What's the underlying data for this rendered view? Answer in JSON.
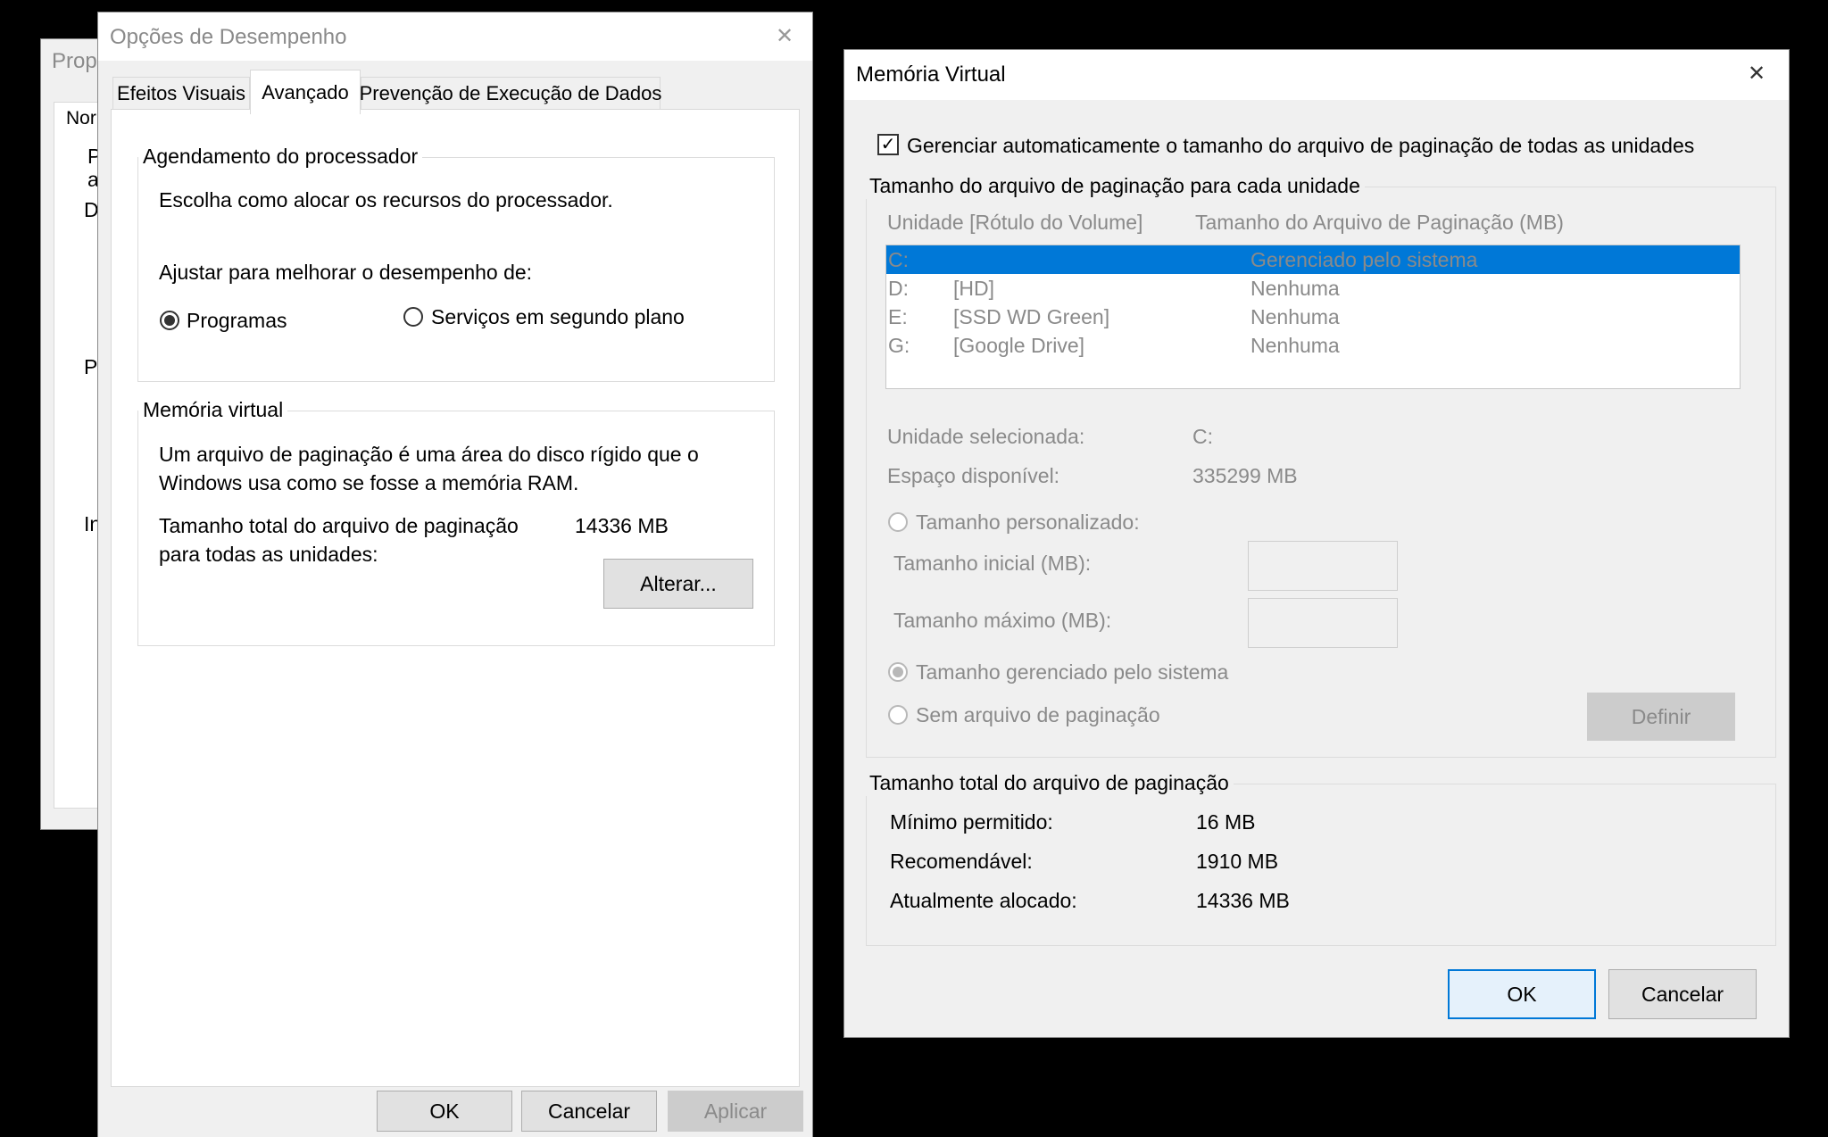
{
  "back_window": {
    "title": "Prop",
    "tab": "Nor",
    "fragments": [
      "P",
      "a",
      "D",
      "P",
      "In"
    ]
  },
  "perf_dialog": {
    "title": "Opções de Desempenho",
    "tabs": [
      {
        "label": "Efeitos Visuais"
      },
      {
        "label": "Avançado"
      },
      {
        "label": "Prevenção de Execução de Dados"
      }
    ],
    "processor_group": {
      "title": "Agendamento do processador",
      "description": "Escolha como alocar os recursos do processador.",
      "adjust_label": "Ajustar para melhorar o desempenho de:",
      "option_programs": "Programas",
      "option_services": "Serviços em segundo plano"
    },
    "vm_group": {
      "title": "Memória virtual",
      "description_line1": "Um arquivo de paginação é uma área do disco rígido que o",
      "description_line2": "Windows usa como se fosse a memória RAM.",
      "total_label_line1": "Tamanho total do arquivo de paginação",
      "total_label_line2": "para todas as unidades:",
      "total_value": "14336 MB",
      "change_button": "Alterar..."
    },
    "buttons": {
      "ok": "OK",
      "cancel": "Cancelar",
      "apply": "Aplicar"
    }
  },
  "vm_dialog": {
    "title": "Memória Virtual",
    "auto_manage_label": "Gerenciar automaticamente o tamanho do arquivo de paginação de todas as unidades",
    "auto_manage_checked": true,
    "drive_group_title": "Tamanho do arquivo de paginação para cada unidade",
    "columns": {
      "drive": "Unidade [Rótulo do Volume]",
      "size": "Tamanho do Arquivo de Paginação (MB)"
    },
    "drives": [
      {
        "letter": "C:",
        "label": "",
        "size": "Gerenciado pelo sistema",
        "selected": true
      },
      {
        "letter": "D:",
        "label": "[HD]",
        "size": "Nenhuma",
        "selected": false
      },
      {
        "letter": "E:",
        "label": "[SSD WD Green]",
        "size": "Nenhuma",
        "selected": false
      },
      {
        "letter": "G:",
        "label": "[Google Drive]",
        "size": "Nenhuma",
        "selected": false
      }
    ],
    "selected_drive_label": "Unidade selecionada:",
    "selected_drive_value": "C:",
    "free_space_label": "Espaço disponível:",
    "free_space_value": "335299 MB",
    "custom_size_label": "Tamanho personalizado:",
    "initial_size_label": "Tamanho inicial (MB):",
    "max_size_label": "Tamanho máximo (MB):",
    "system_managed_label": "Tamanho gerenciado pelo sistema",
    "no_paging_label": "Sem arquivo de paginação",
    "set_button": "Definir",
    "total_group_title": "Tamanho total do arquivo de paginação",
    "min_label": "Mínimo permitido:",
    "min_value": "16 MB",
    "recommended_label": "Recomendável:",
    "recommended_value": "1910 MB",
    "allocated_label": "Atualmente alocado:",
    "allocated_value": "14336 MB",
    "buttons": {
      "ok": "OK",
      "cancel": "Cancelar"
    }
  },
  "icons": {
    "close": "close-icon",
    "check": "check-icon"
  },
  "colors": {
    "selection": "#0078d7",
    "dialog_bg": "#f0f0f0",
    "disabled_text": "#8a8a8a"
  }
}
